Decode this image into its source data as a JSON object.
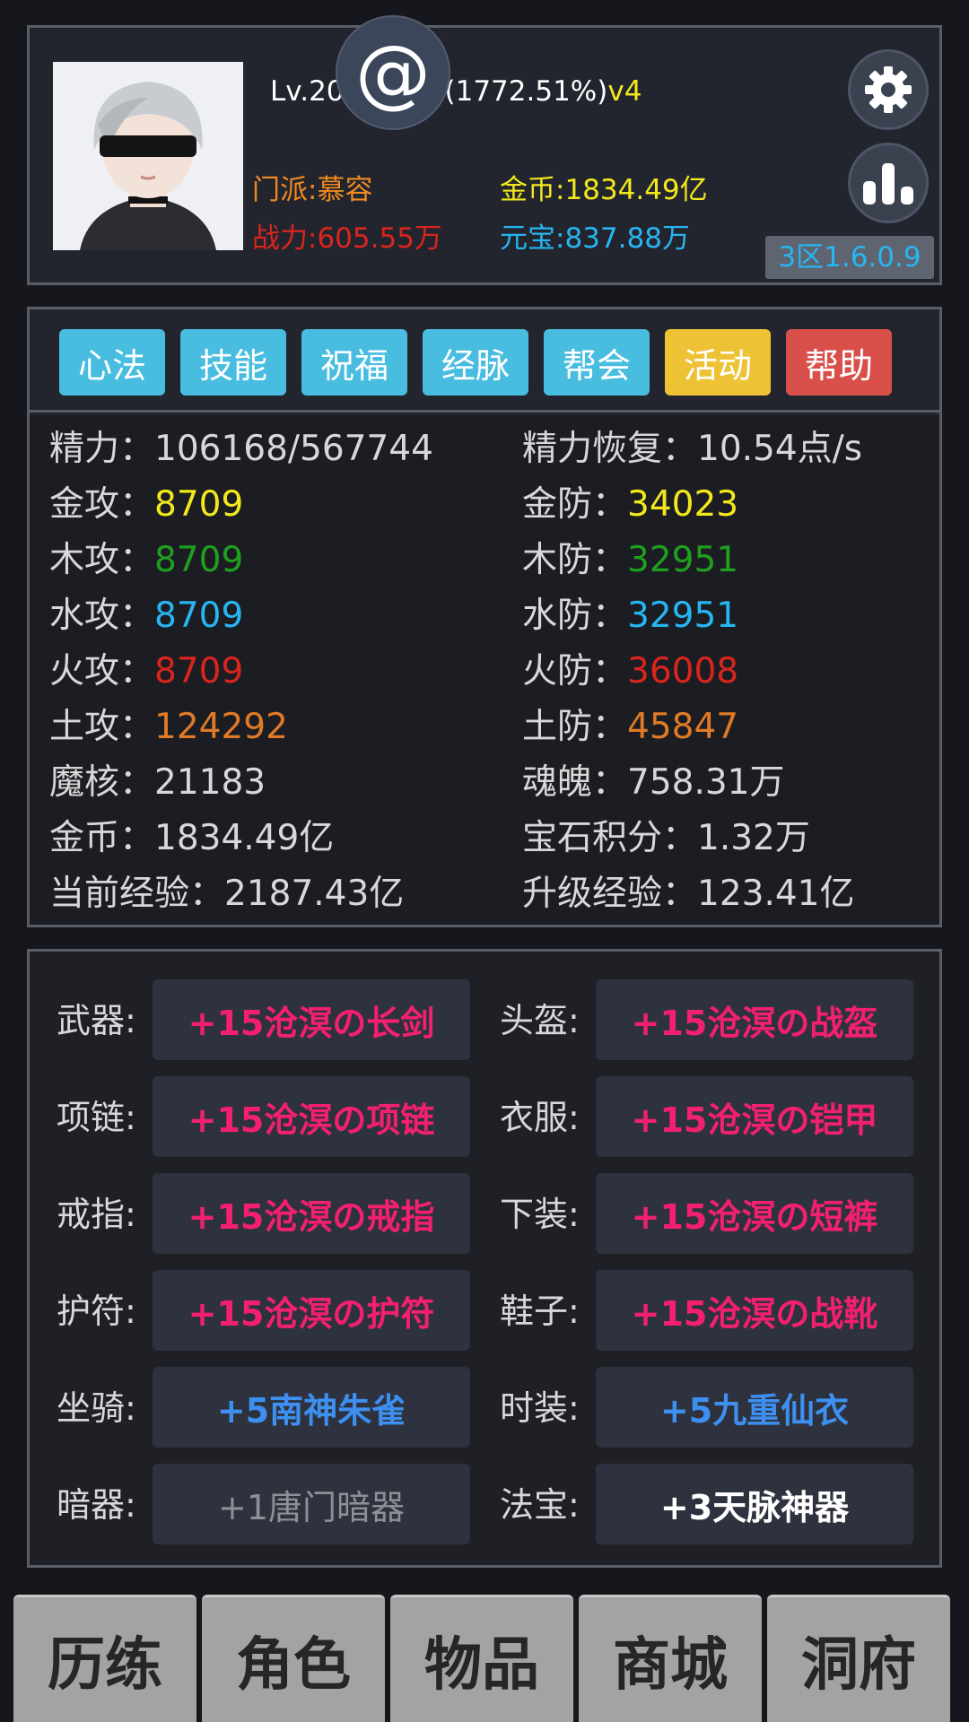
{
  "profile": {
    "level_text": "Lv.20",
    "exp_percent": "(1772.51%)",
    "vip": "v4",
    "sect": "门派:慕容",
    "power": "战力:605.55万",
    "gold": "金币:1834.49亿",
    "ingot": "元宝:837.88万",
    "server": "3区1.6.0.9",
    "at_label": "@"
  },
  "menu": [
    {
      "label": "心法",
      "color": "#48bde0"
    },
    {
      "label": "技能",
      "color": "#48bde0"
    },
    {
      "label": "祝福",
      "color": "#48bde0"
    },
    {
      "label": "经脉",
      "color": "#48bde0"
    },
    {
      "label": "帮会",
      "color": "#48bde0"
    },
    {
      "label": "活动",
      "color": "#eec235"
    },
    {
      "label": "帮助",
      "color": "#d9504a"
    }
  ],
  "stats": {
    "left": [
      {
        "label": "精力：",
        "value": "106168/567744",
        "color": "#d8d8d8"
      },
      {
        "label": "金攻：",
        "value": "8709",
        "color": "#f2e81c"
      },
      {
        "label": "木攻：",
        "value": "8709",
        "color": "#1ea01e"
      },
      {
        "label": "水攻：",
        "value": "8709",
        "color": "#27b6f2"
      },
      {
        "label": "火攻：",
        "value": "8709",
        "color": "#d9251d"
      },
      {
        "label": "土攻：",
        "value": "124292",
        "color": "#e07a26"
      },
      {
        "label": "魔核：",
        "value": "21183",
        "color": "#d8d8d8"
      },
      {
        "label": "金币：",
        "value": "1834.49亿",
        "color": "#d8d8d8"
      },
      {
        "label": "当前经验：",
        "value": "2187.43亿",
        "color": "#d8d8d8"
      }
    ],
    "right": [
      {
        "label": "精力恢复：",
        "value": "10.54点/s",
        "color": "#d8d8d8"
      },
      {
        "label": "金防：",
        "value": "34023",
        "color": "#f2e81c"
      },
      {
        "label": "木防：",
        "value": "32951",
        "color": "#1ea01e"
      },
      {
        "label": "水防：",
        "value": "32951",
        "color": "#27b6f2"
      },
      {
        "label": "火防：",
        "value": "36008",
        "color": "#d9251d"
      },
      {
        "label": "土防：",
        "value": "45847",
        "color": "#e07a26"
      },
      {
        "label": "魂魄：",
        "value": "758.31万",
        "color": "#d8d8d8"
      },
      {
        "label": "宝石积分：",
        "value": "1.32万",
        "color": "#d8d8d8"
      },
      {
        "label": "升级经验：",
        "value": "123.41亿",
        "color": "#d8d8d8"
      }
    ]
  },
  "equipment": {
    "left": [
      {
        "label": "武器:",
        "item": "+15沧溟の长剑",
        "color": "#f2206e"
      },
      {
        "label": "项链:",
        "item": "+15沧溟の项链",
        "color": "#f2206e"
      },
      {
        "label": "戒指:",
        "item": "+15沧溟の戒指",
        "color": "#f2206e"
      },
      {
        "label": "护符:",
        "item": "+15沧溟の护符",
        "color": "#f2206e"
      },
      {
        "label": "坐骑:",
        "item": "+5南神朱雀",
        "color": "#3d8ff0"
      },
      {
        "label": "暗器:",
        "item": "+1唐门暗器",
        "color": "#8e9096"
      }
    ],
    "right": [
      {
        "label": "头盔:",
        "item": "+15沧溟の战盔",
        "color": "#f2206e"
      },
      {
        "label": "衣服:",
        "item": "+15沧溟の铠甲",
        "color": "#f2206e"
      },
      {
        "label": "下装:",
        "item": "+15沧溟の短裤",
        "color": "#f2206e"
      },
      {
        "label": "鞋子:",
        "item": "+15沧溟の战靴",
        "color": "#f2206e"
      },
      {
        "label": "时装:",
        "item": "+5九重仙衣",
        "color": "#3d8ff0"
      },
      {
        "label": "法宝:",
        "item": "+3天脉神器",
        "color": "#ffffff"
      }
    ]
  },
  "nav": [
    {
      "label": "历练"
    },
    {
      "label": "角色"
    },
    {
      "label": "物品"
    },
    {
      "label": "商城"
    },
    {
      "label": "洞府"
    }
  ],
  "icons": {
    "settings": "gear-icon",
    "rank": "bar-chart-icon",
    "mention": "at-icon"
  }
}
